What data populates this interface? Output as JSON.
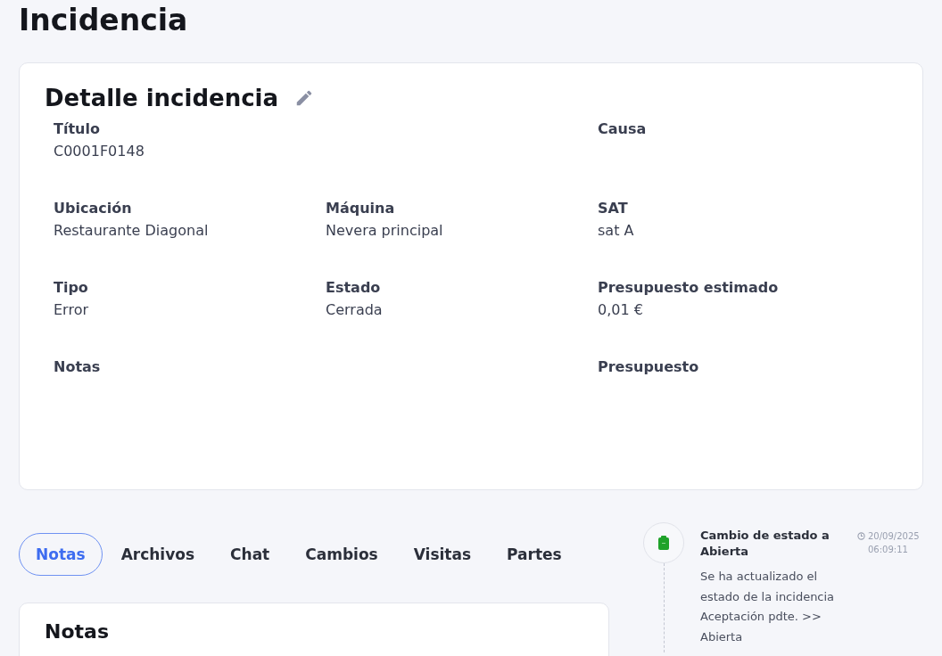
{
  "page_title": "Incidencia",
  "detail": {
    "title": "Detalle incidencia",
    "rows": [
      {
        "col_1": {
          "label": "Título",
          "value": "C0001F0148"
        },
        "col_3": {
          "label": "Causa"
        }
      },
      {
        "col_1": {
          "label": "Ubicación",
          "value": "Restaurante Diagonal"
        },
        "col_2": {
          "label": "Máquina",
          "value": "Nevera principal"
        },
        "col_3": {
          "label": "SAT",
          "value": "sat A"
        }
      },
      {
        "col_1": {
          "label": "Tipo",
          "value": "Error"
        },
        "col_2": {
          "label": "Estado",
          "value": "Cerrada"
        },
        "col_3": {
          "label": "Presupuesto estimado",
          "value": "0,01 €"
        }
      },
      {
        "col_1": {
          "label": "Notas"
        },
        "col_3": {
          "label": "Presupuesto"
        }
      }
    ]
  },
  "tabs": [
    {
      "label": "Notas",
      "selected": true
    },
    {
      "label": "Archivos",
      "selected": false
    },
    {
      "label": "Chat",
      "selected": false
    },
    {
      "label": "Cambios",
      "selected": false
    },
    {
      "label": "Visitas",
      "selected": false
    },
    {
      "label": "Partes",
      "selected": false
    }
  ],
  "notes_card": {
    "title": "Notas"
  },
  "timeline": [
    {
      "title": "Cambio de estado a Abierta",
      "time": "20/09/2025 06:09:11",
      "text": "Se ha actualizado el estado de la incidencia Aceptación pdte. >> Abierta"
    }
  ]
}
